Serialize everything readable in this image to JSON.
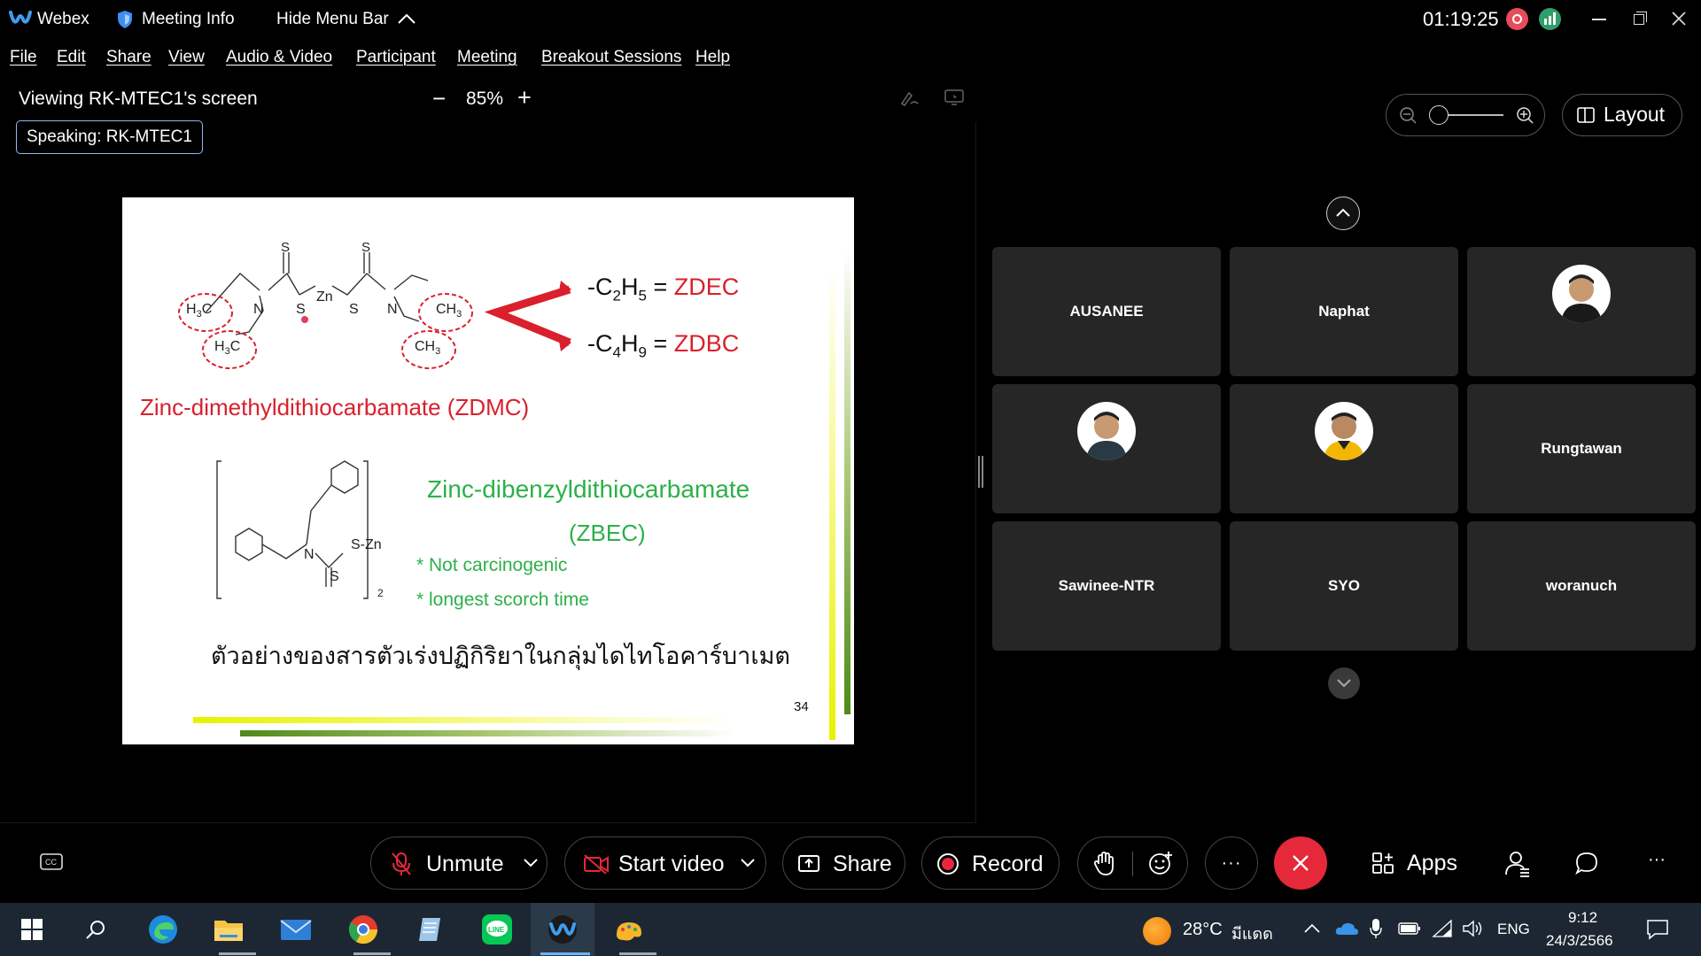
{
  "titlebar": {
    "app_name": "Webex",
    "meeting_info": "Meeting Info",
    "hide_menu_bar": "Hide Menu Bar",
    "timer": "01:19:25"
  },
  "menu": [
    "File",
    "Edit",
    "Share",
    "View",
    "Audio & Video",
    "Participant",
    "Meeting",
    "Breakout Sessions",
    "Help"
  ],
  "share_toolbar": {
    "viewing_label": "Viewing RK-MTEC1's screen",
    "zoom_minus": "−",
    "zoom_value": "85%",
    "zoom_plus": "+",
    "speaking": "Speaking: RK-MTEC1"
  },
  "slide": {
    "zdec_formula_left": "-C",
    "zdec_sub1": "2",
    "zdec_h": "H",
    "zdec_sub2": "5",
    "zdec_eq": "= ",
    "zdec_name": "ZDEC",
    "zdbc_formula_left": "-C",
    "zdbc_sub1": "4",
    "zdbc_h": "H",
    "zdbc_sub2": "9",
    "zdbc_eq": "= ",
    "zdbc_name": "ZDBC",
    "zdmc_title": "Zinc-dimethyldithiocarbamate (ZDMC)",
    "zbec_title_line1": "Zinc-dibenzyldithiocarbamate",
    "zbec_title_line2": "(ZBEC)",
    "bullet1": "* Not carcinogenic",
    "bullet2": "* longest scorch time",
    "thai_caption": "ตัวอย่างของสารตัวเร่งปฏิกิริยาในกลุ่มไดไทโอคาร์บาเมต",
    "page_number": "34",
    "mol_h3c_1": "H3C",
    "mol_h3c_2": "H3C",
    "mol_ch3_1": "CH3",
    "mol_ch3_2": "CH3",
    "mol_n": "N",
    "mol_s": "S",
    "mol_zn": "Zn",
    "mol_szn": "S-Zn",
    "mol_sub2": "2",
    "colors": {
      "red": "#d9202c",
      "green": "#2db04a"
    }
  },
  "right_panel": {
    "layout_label": "Layout",
    "participants": [
      {
        "name": "AUSANEE",
        "has_avatar": false
      },
      {
        "name": "Naphat",
        "has_avatar": false
      },
      {
        "name": "",
        "has_avatar": true
      },
      {
        "name": "",
        "has_avatar": true
      },
      {
        "name": "",
        "has_avatar": true
      },
      {
        "name": "Rungtawan",
        "has_avatar": false
      },
      {
        "name": "Sawinee-NTR",
        "has_avatar": false
      },
      {
        "name": "SYO",
        "has_avatar": false
      },
      {
        "name": "woranuch",
        "has_avatar": false
      }
    ]
  },
  "controls": {
    "unmute": "Unmute",
    "start_video": "Start video",
    "share": "Share",
    "record": "Record",
    "apps": "Apps",
    "more": "···",
    "end_color": "#e5283a"
  },
  "taskbar": {
    "weather": "28°C",
    "weather_desc": "มีแดด",
    "lang": "ENG",
    "time": "9:12",
    "date": "24/3/2566"
  }
}
